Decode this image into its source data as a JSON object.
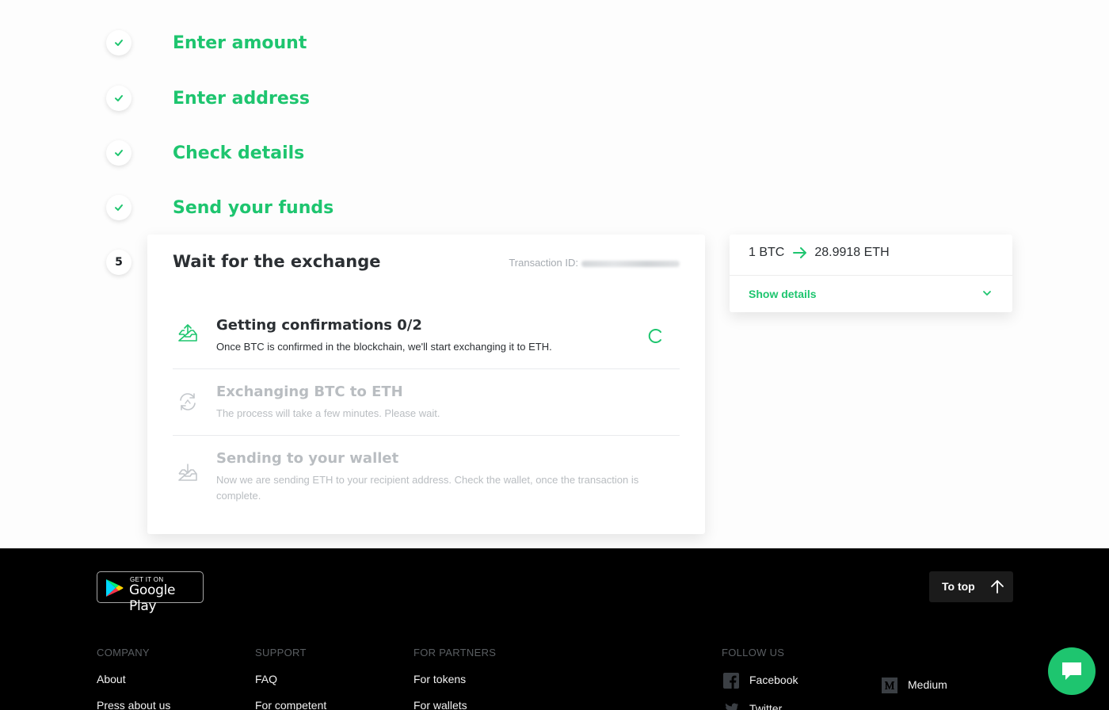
{
  "steps": [
    {
      "label": "Enter amount",
      "status": "done"
    },
    {
      "label": "Enter address",
      "status": "done"
    },
    {
      "label": "Check details",
      "status": "done"
    },
    {
      "label": "Send your funds",
      "status": "done"
    },
    {
      "label": "Wait for the exchange",
      "number": "5",
      "status": "active"
    }
  ],
  "exchange": {
    "title": "Wait for the exchange",
    "txid_label": "Transaction ID:",
    "substeps": [
      {
        "icon": "upload-tray-icon",
        "title": "Getting confirmations 0/2",
        "desc": "Once BTC is confirmed in the blockchain, we'll start exchanging it to ETH.",
        "state": "active"
      },
      {
        "icon": "exchange-cycle-icon",
        "title": "Exchanging BTC to ETH",
        "desc": "The process will take a few minutes. Please wait.",
        "state": "pending"
      },
      {
        "icon": "download-tray-icon",
        "title": "Sending to your wallet",
        "desc": "Now we are sending ETH to your recipient address. Check the wallet, once the transaction is complete.",
        "state": "pending"
      }
    ]
  },
  "rate": {
    "from": "1 BTC",
    "to": "28.9918 ETH",
    "show_details": "Show details"
  },
  "footer": {
    "gplay_small": "GET IT ON",
    "gplay_big": "Google Play",
    "to_top": "To top",
    "columns": [
      {
        "heading": "COMPANY",
        "links": [
          "About",
          "Press about us"
        ]
      },
      {
        "heading": "SUPPORT",
        "links": [
          "FAQ",
          "For competent"
        ]
      },
      {
        "heading": "FOR PARTNERS",
        "links": [
          "For tokens",
          "For wallets"
        ]
      },
      {
        "heading": "FOLLOW US",
        "links": [
          "Facebook",
          "Twitter"
        ]
      }
    ],
    "medium": "Medium"
  },
  "colors": {
    "accent": "#1ec56f",
    "text": "#2b2f33",
    "muted": "#a5aab0",
    "footer_bg": "#000000"
  }
}
